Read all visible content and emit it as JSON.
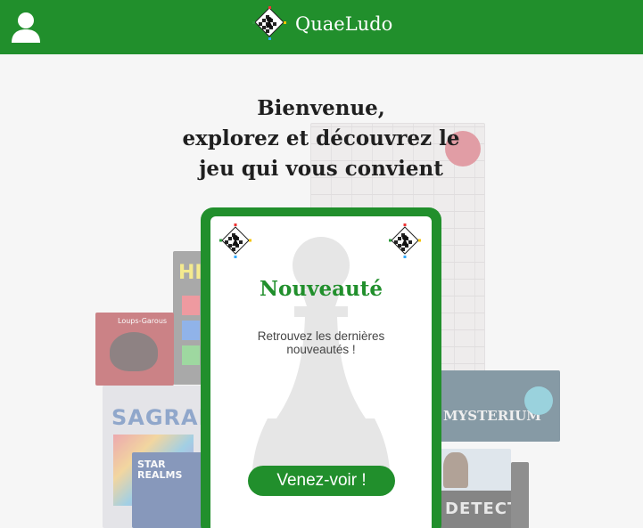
{
  "header": {
    "brand_name": "QuaeLudo",
    "user_icon": "user-icon",
    "logo_icon": "chess-logo-icon",
    "background_color": "#218f2c"
  },
  "hero": {
    "headline_line1": "Bienvenue,",
    "headline_line2": "explorez et découvrez le",
    "headline_line3": "jeu qui vous convient",
    "background_boxes": [
      {
        "label": "Loups-Garous"
      },
      {
        "label": "HI"
      },
      {
        "label": "SAGRADA"
      },
      {
        "label": "STAR REALMS"
      },
      {
        "label": "MYSTERIUM"
      },
      {
        "label": "DETECTIVE"
      }
    ]
  },
  "card": {
    "title": "Nouveauté",
    "text": "Retrouvez les dernières nouveautés !",
    "button_label": "Venez-voir !",
    "accent_color": "#218f2c",
    "watermark_icon": "pawn-icon"
  }
}
